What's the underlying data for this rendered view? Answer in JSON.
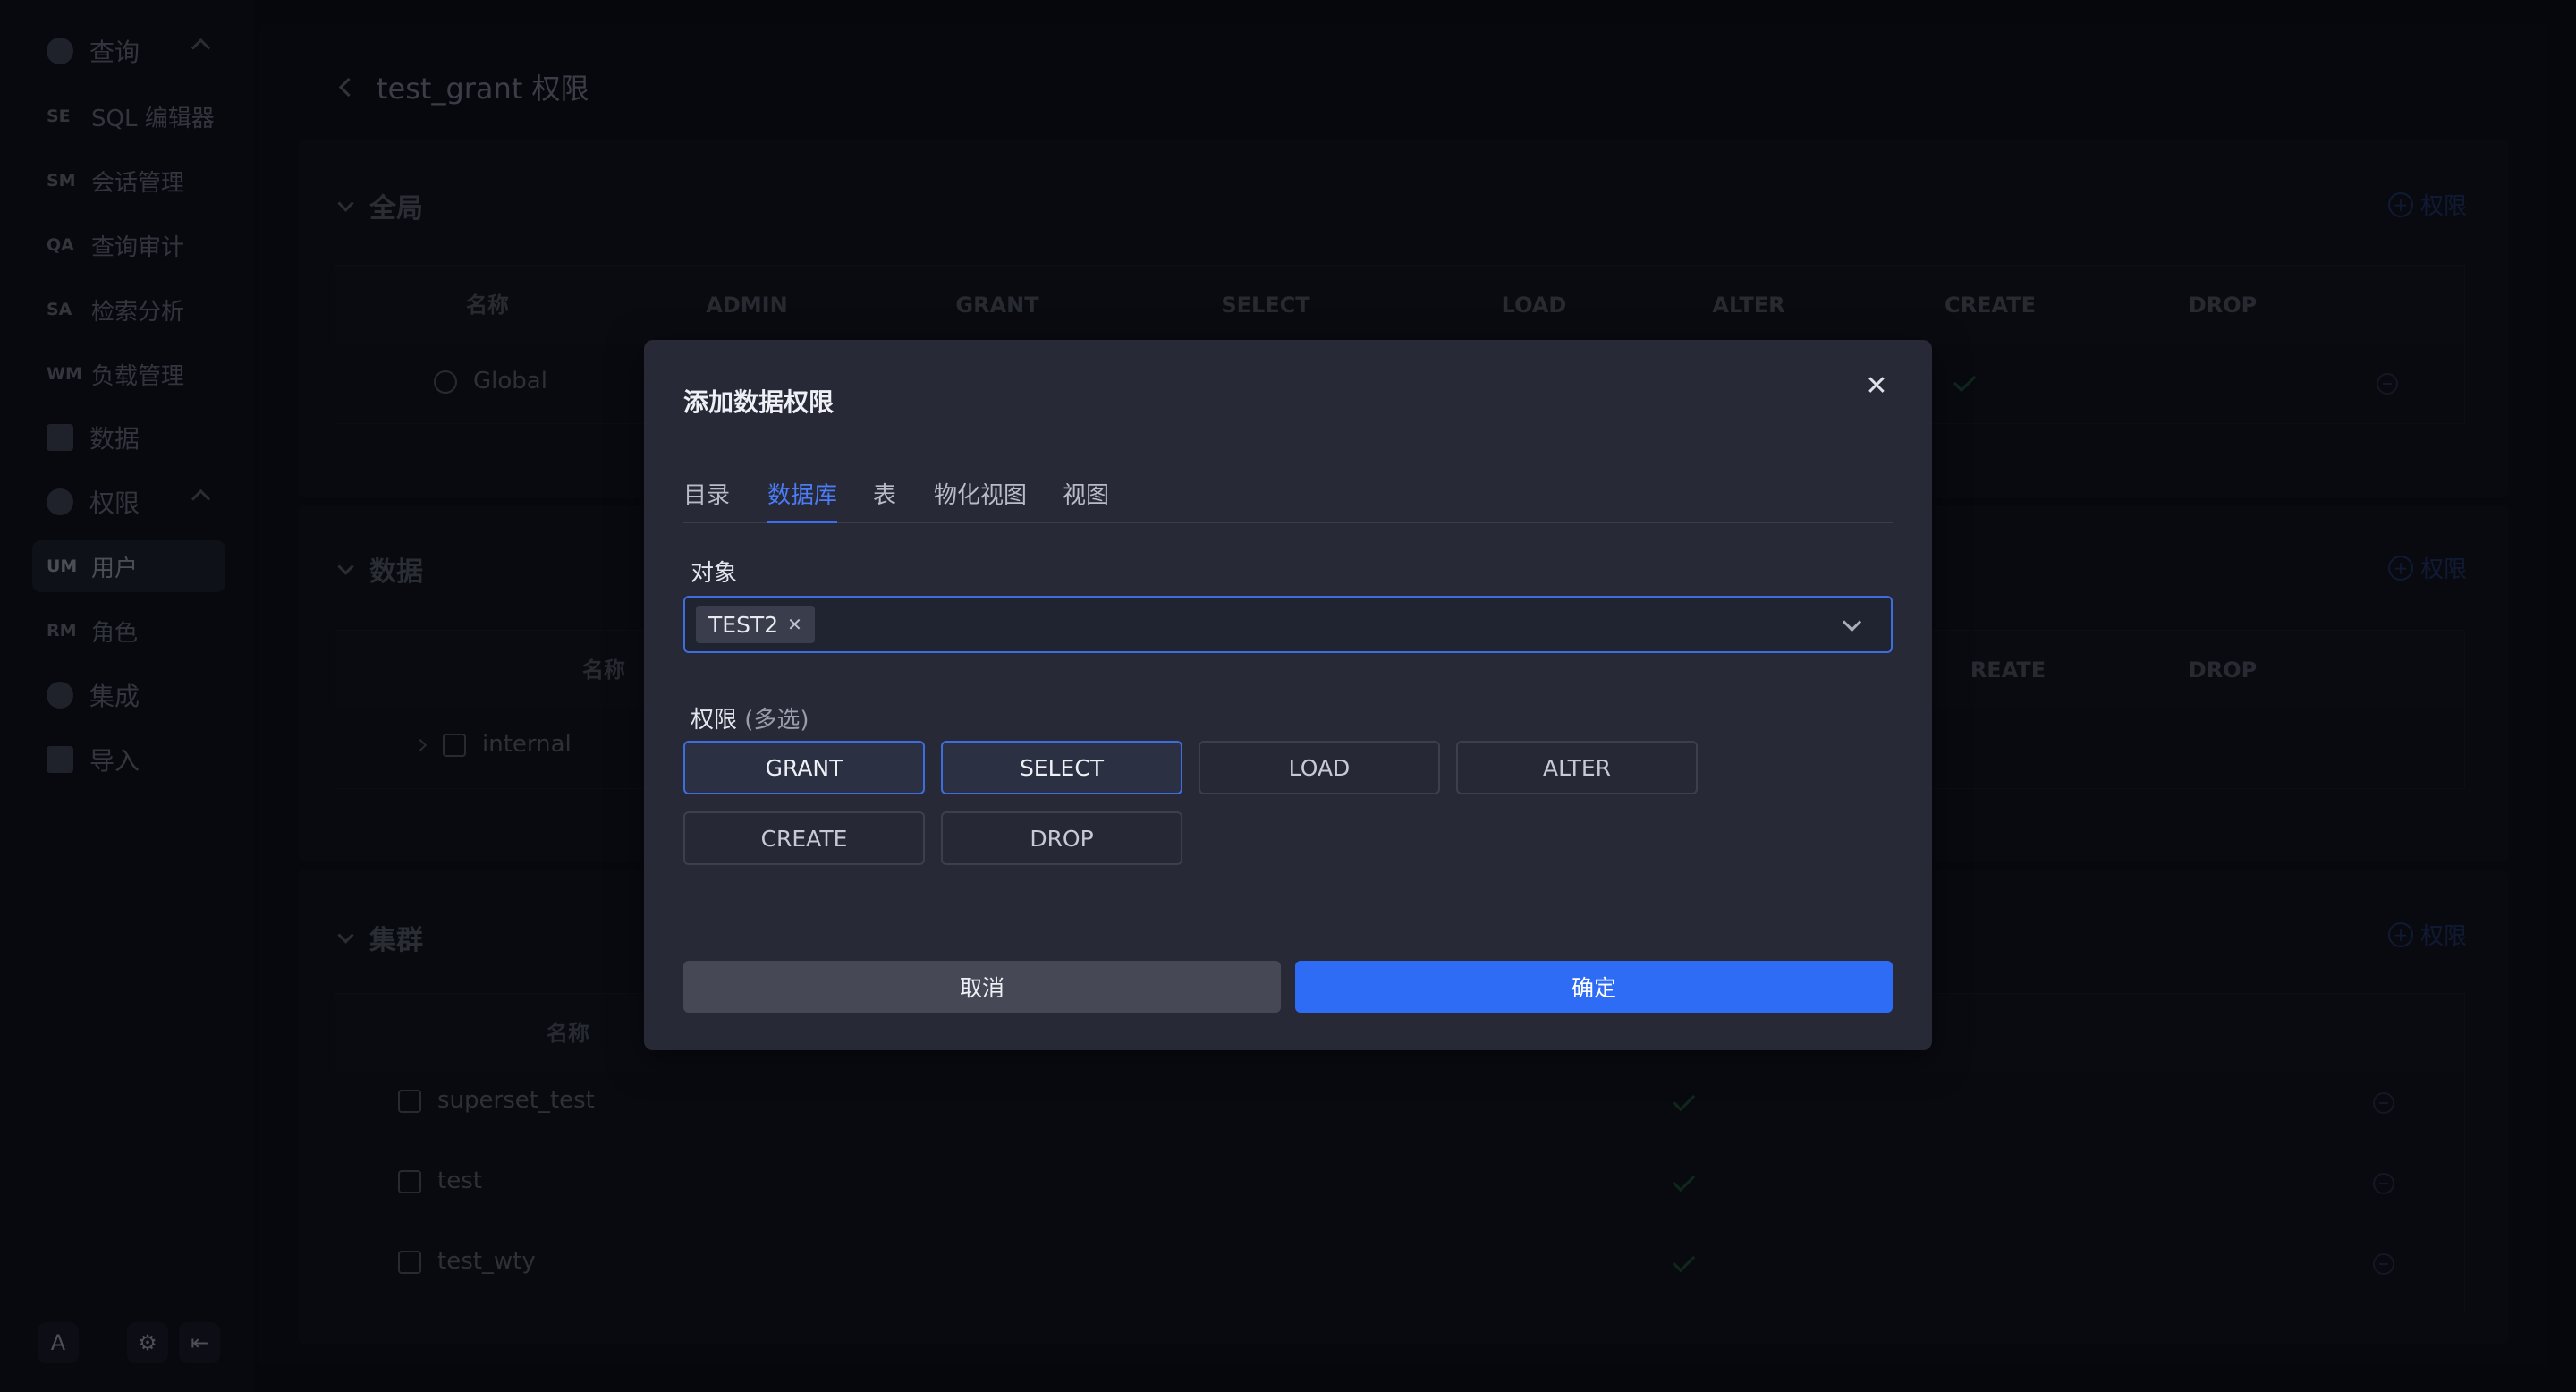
{
  "sidebar": {
    "items": [
      {
        "abbr": "",
        "label": "查询",
        "icon": "query-icon"
      },
      {
        "abbr": "SE",
        "label": "SQL 编辑器"
      },
      {
        "abbr": "SM",
        "label": "会话管理"
      },
      {
        "abbr": "QA",
        "label": "查询审计"
      },
      {
        "abbr": "SA",
        "label": "检索分析"
      },
      {
        "abbr": "WM",
        "label": "负载管理"
      },
      {
        "abbr": "",
        "label": "数据",
        "icon": "database-icon"
      },
      {
        "abbr": "",
        "label": "权限",
        "icon": "shield-icon"
      },
      {
        "abbr": "UM",
        "label": "用户"
      },
      {
        "abbr": "RM",
        "label": "角色"
      },
      {
        "abbr": "",
        "label": "集成",
        "icon": "integration-icon"
      },
      {
        "abbr": "",
        "label": "导入",
        "icon": "folder-icon"
      }
    ],
    "avatar": "A"
  },
  "page": {
    "title": "test_grant 权限"
  },
  "sections": {
    "global": {
      "title": "全局",
      "add_label": "权限",
      "headers": [
        "名称",
        "ADMIN",
        "GRANT",
        "SELECT",
        "LOAD",
        "ALTER",
        "CREATE",
        "DROP"
      ],
      "row_name": "Global"
    },
    "data": {
      "title": "数据",
      "add_label": "权限",
      "headers": [
        "名称",
        "REATE",
        "DROP"
      ],
      "row_name": "internal"
    },
    "cluster": {
      "title": "集群",
      "add_label": "权限",
      "headers": [
        "名称"
      ],
      "rows": [
        "superset_test",
        "test",
        "test_wty"
      ]
    }
  },
  "modal": {
    "title": "添加数据权限",
    "tabs": [
      "目录",
      "数据库",
      "表",
      "物化视图",
      "视图"
    ],
    "active_tab": "数据库",
    "object_label": "对象",
    "object_tag": "TEST2",
    "perm_label": "权限",
    "perm_hint": "(多选)",
    "permissions": [
      {
        "label": "GRANT",
        "selected": true
      },
      {
        "label": "SELECT",
        "selected": true
      },
      {
        "label": "LOAD",
        "selected": false
      },
      {
        "label": "ALTER",
        "selected": false
      },
      {
        "label": "CREATE",
        "selected": false
      },
      {
        "label": "DROP",
        "selected": false
      }
    ],
    "cancel_label": "取消",
    "ok_label": "确定"
  },
  "colors": {
    "accent": "#2f6cf6",
    "background": "#0b0d17",
    "modal_bg": "#272a36"
  }
}
